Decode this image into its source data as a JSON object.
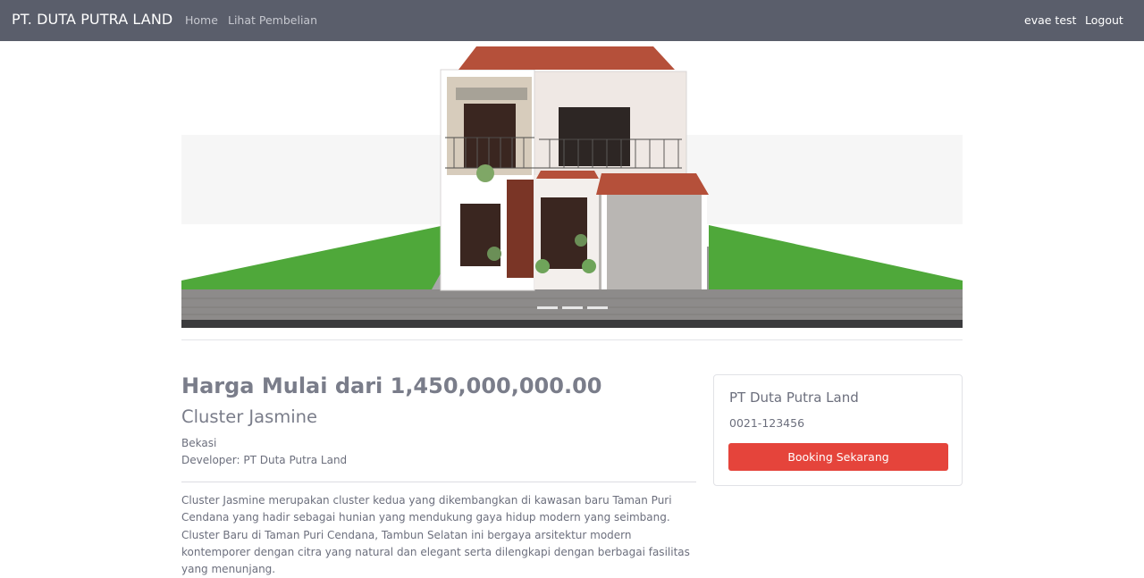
{
  "navbar": {
    "brand": "PT. DUTA PUTRA LAND",
    "links": [
      "Home",
      "Lihat Pembelian"
    ],
    "user": "evae test",
    "logout": "Logout"
  },
  "carousel": {
    "slide_count": 3,
    "active_index": 0
  },
  "listing": {
    "price": "Harga Mulai dari 1,450,000,000.00",
    "cluster": "Cluster Jasmine",
    "location": "Bekasi",
    "developer": "Developer: PT Duta Putra Land",
    "description": "Cluster Jasmine merupakan cluster kedua yang dikembangkan di kawasan baru Taman Puri Cendana yang hadir sebagai hunian yang mendukung gaya hidup modern yang seimbang. Cluster Baru di Taman Puri Cendana, Tambun Selatan ini bergaya arsitektur modern kontemporer dengan citra yang natural dan elegant serta dilengkapi dengan berbagai fasilitas yang menunjang."
  },
  "contact_card": {
    "company": "PT Duta Putra Land",
    "phone": "0021-123456",
    "cta": "Booking Sekarang"
  },
  "colors": {
    "navbar_bg": "#5a5e6b",
    "cta_bg": "#e5443b",
    "roof": "#b5503a",
    "grass": "#4fa83a"
  }
}
